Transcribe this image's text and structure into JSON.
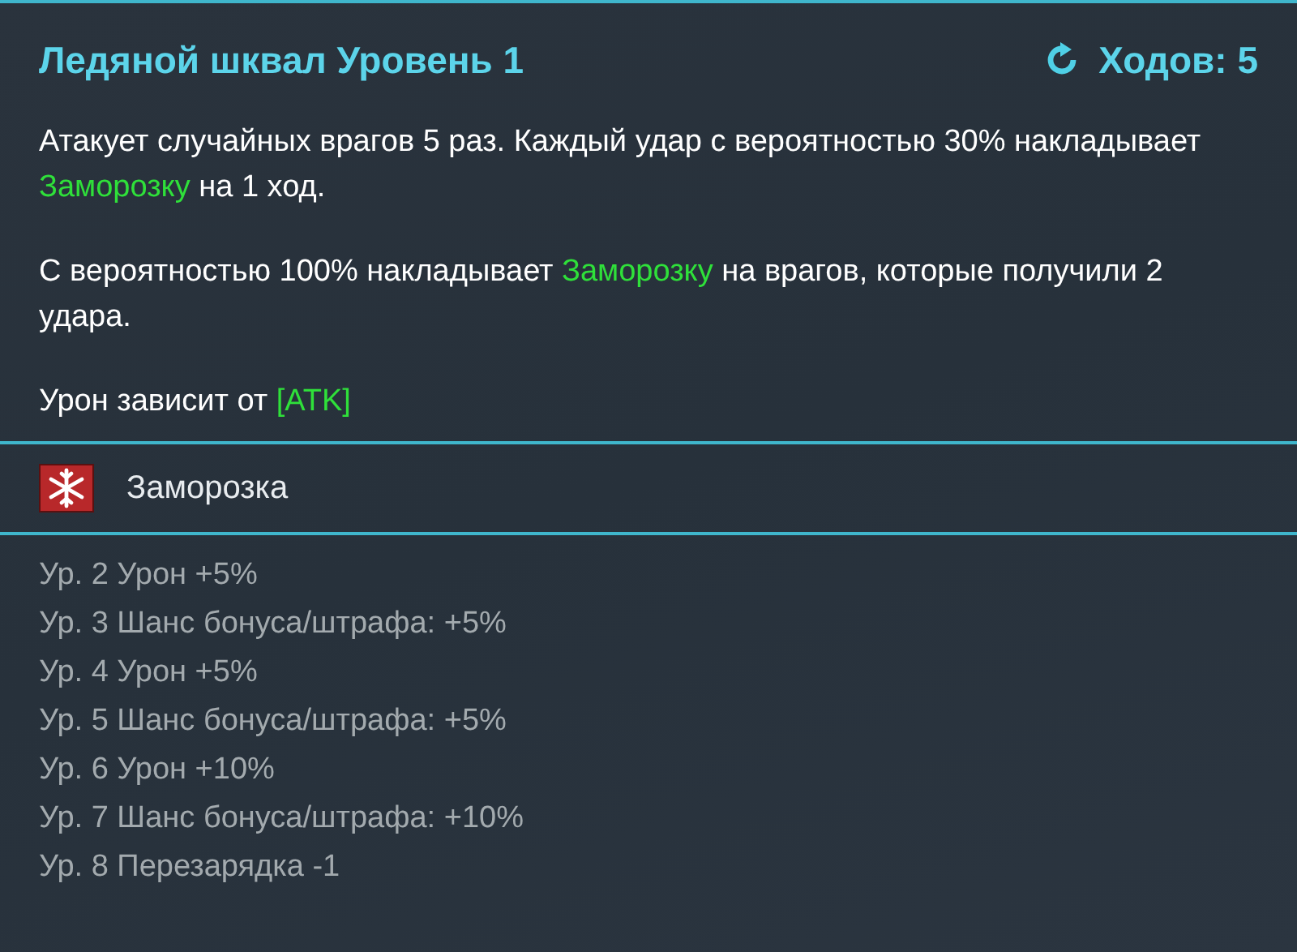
{
  "skill": {
    "title": "Ледяной шквал Уровень 1",
    "cooldown": "Ходов: 5"
  },
  "description": [
    [
      {
        "text": "Атакует случайных врагов 5 раз. Каждый удар с вероятностью 30% накладывает ",
        "kind": "plain"
      },
      {
        "text": "Заморозку",
        "kind": "effect"
      },
      {
        "text": " на 1 ход.",
        "kind": "plain"
      }
    ],
    [
      {
        "text": "С вероятностью 100% накладывает ",
        "kind": "plain"
      },
      {
        "text": "Заморозку",
        "kind": "effect"
      },
      {
        "text": " на врагов, которые получили 2 удара.",
        "kind": "plain"
      }
    ],
    [
      {
        "text": "Урон зависит от  ",
        "kind": "plain"
      },
      {
        "text": "[ATK]",
        "kind": "effect"
      }
    ]
  ],
  "effects": [
    {
      "name": "Заморозка"
    }
  ],
  "level_ups": [
    "Ур. 2 Урон +5%",
    "Ур. 3 Шанс бонуса/штрафа: +5%",
    "Ур. 4 Урон +5%",
    "Ур. 5 Шанс бонуса/штрафа: +5%",
    "Ур. 6 Урон +10%",
    "Ур. 7 Шанс бонуса/штрафа: +10%",
    "Ур. 8 Перезарядка -1"
  ]
}
